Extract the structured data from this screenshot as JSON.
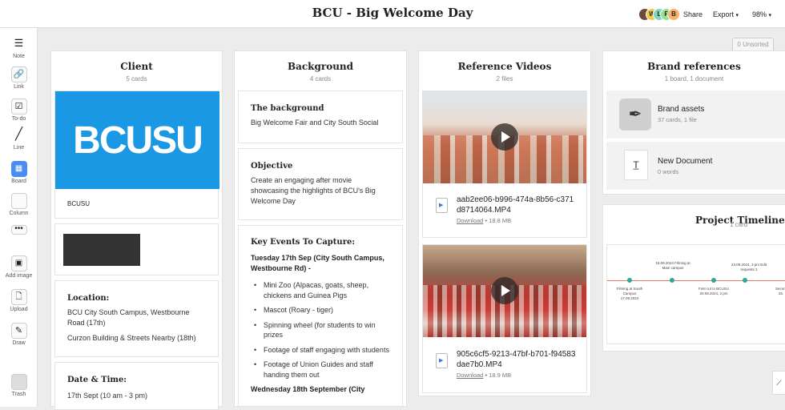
{
  "header": {
    "title": "BCU - Big Welcome Day",
    "share": "Share",
    "export": "Export",
    "zoom": "98%",
    "avatars": [
      {
        "initial": "",
        "color": "#6b4a3a"
      },
      {
        "initial": "W",
        "color": "#f2c94c"
      },
      {
        "initial": "L",
        "color": "#7ed6c0"
      },
      {
        "initial": "P",
        "color": "#9be08a"
      },
      {
        "initial": "B",
        "color": "#f7b267"
      }
    ]
  },
  "sidebar": [
    {
      "label": "Note",
      "icon": "note-icon"
    },
    {
      "label": "Link",
      "icon": "link-icon"
    },
    {
      "label": "To-do",
      "icon": "todo-icon"
    },
    {
      "label": "Line",
      "icon": "line-icon"
    },
    {
      "label": "Board",
      "icon": "board-icon"
    },
    {
      "label": "Column",
      "icon": "column-icon"
    },
    {
      "label": "",
      "icon": "more-icon"
    },
    {
      "label": "Add image",
      "icon": "add-image-icon"
    },
    {
      "label": "Upload",
      "icon": "upload-icon"
    },
    {
      "label": "Draw",
      "icon": "draw-icon"
    },
    {
      "label": "Trash",
      "icon": "trash-icon"
    }
  ],
  "unsorted": "0 Unsorted",
  "client": {
    "title": "Client",
    "count": "5 cards",
    "logo": "BCUSU",
    "logo_caption": "BCUSU",
    "location_heading": "Location:",
    "location1": "BCU City South Campus, Westbourne Road (17th)",
    "location2": "Curzon Building & Streets Nearby (18th)",
    "date_heading": "Date & Time:",
    "date1": "17th Sept (10 am - 3 pm)"
  },
  "background": {
    "title": "Background",
    "count": "4 cards",
    "bg_heading": "The background",
    "bg_text": "Big Welcome Fair and City South Social",
    "obj_heading": "Objective",
    "obj_text": "Create an engaging after movie showcasing the highlights of BCU's Big Welcome Day",
    "events_heading": "Key Events To Capture:",
    "tue_heading": "Tuesday 17th Sep (City South Campus, Westbourne Rd) -",
    "bullets": [
      "Mini Zoo (Alpacas, goats, sheep, chickens and Guinea Pigs",
      "Mascot (Roary - tiger)",
      "Spinning wheel (for students to win prizes",
      "Footage of staff engaging with students",
      "Footage of Union Guides and staff handing them out"
    ],
    "wed_heading": "Wednesday 18th September (City"
  },
  "videos": {
    "title": "Reference Videos",
    "count": "2 files",
    "files": [
      {
        "name": "aab2ee06-b996-474a-8b56-c371d8714064.MP4",
        "download": "Download",
        "size": "18.8 MB"
      },
      {
        "name": "905c6cf5-9213-47bf-b701-f94583dae7b0.MP4",
        "download": "Download",
        "size": "18.9 MB"
      }
    ]
  },
  "brand": {
    "title": "Brand references",
    "count": "1 board, 1 document",
    "assets_label": "Brand assets",
    "assets_meta": "37 cards, 1 file",
    "doc_label": "New Document",
    "doc_meta": "0 words"
  },
  "timeline": {
    "title": "Project Timeline",
    "count": "1 card",
    "points": [
      "Filming at South Campus 17.09.2024",
      "18.09.2024 Filming at Main campus",
      "First cut to BCUSU 20.09.2024, 3 pm",
      "23.09.2024, 3 pm Edit requests 1",
      "Second 25."
    ]
  },
  "colors": {
    "brand_blue": "#1a98e4",
    "timeline": "#2aa89a"
  }
}
